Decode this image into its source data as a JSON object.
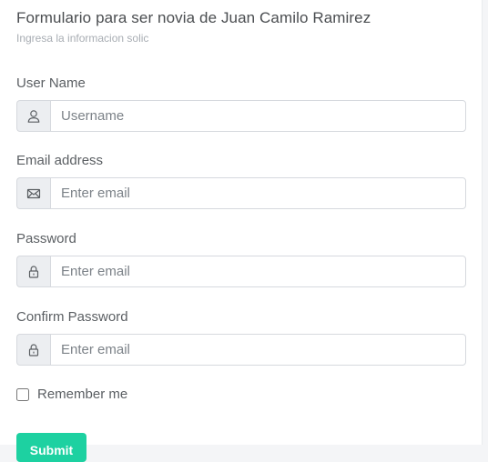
{
  "form": {
    "title": "Formulario para ser novia de Juan Camilo Ramirez",
    "subtitle": "Ingresa la informacion solic",
    "fields": [
      {
        "label": "User Name",
        "placeholder": "Username",
        "value": "",
        "icon": "user-icon"
      },
      {
        "label": "Email address",
        "placeholder": "Enter email",
        "value": "",
        "icon": "envelope-icon"
      },
      {
        "label": "Password",
        "placeholder": "Enter email",
        "value": "",
        "icon": "lock-icon"
      },
      {
        "label": "Confirm Password",
        "placeholder": "Enter email",
        "value": "",
        "icon": "lock-icon"
      }
    ],
    "remember_label": "Remember me",
    "remember_checked": false,
    "submit_label": "Submit"
  },
  "colors": {
    "accent": "#1dd1a1",
    "addon_bg": "#eceef1",
    "border": "#d6d9de",
    "text": "#5b5f63"
  }
}
